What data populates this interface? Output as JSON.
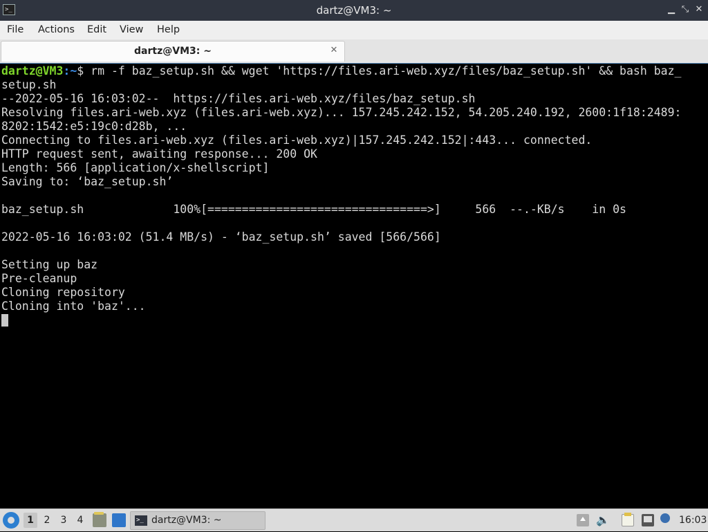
{
  "window": {
    "title": "dartz@VM3: ~",
    "app_icon_glyph": ">_",
    "minimize_glyph": "▁",
    "restore_glyph": "⤡",
    "close_glyph": "✕"
  },
  "menu": [
    "File",
    "Actions",
    "Edit",
    "View",
    "Help"
  ],
  "tab": {
    "label": "dartz@VM3: ~",
    "close_glyph": "✕"
  },
  "terminal": {
    "prompt_user": "dartz@VM3",
    "prompt_path": ":~",
    "prompt_symbol": "$",
    "command": " rm -f baz_setup.sh && wget 'https://files.ari-web.xyz/files/baz_setup.sh' && bash baz_",
    "output": "setup.sh\n--2022-05-16 16:03:02--  https://files.ari-web.xyz/files/baz_setup.sh\nResolving files.ari-web.xyz (files.ari-web.xyz)... 157.245.242.152, 54.205.240.192, 2600:1f18:2489:\n8202:1542:e5:19c0:d28b, ...\nConnecting to files.ari-web.xyz (files.ari-web.xyz)|157.245.242.152|:443... connected.\nHTTP request sent, awaiting response... 200 OK\nLength: 566 [application/x-shellscript]\nSaving to: ‘baz_setup.sh’\n\nbaz_setup.sh             100%[================================>]     566  --.-KB/s    in 0s\n\n2022-05-16 16:03:02 (51.4 MB/s) - ‘baz_setup.sh’ saved [566/566]\n\nSetting up baz\nPre-cleanup\nCloning repository\nCloning into 'baz'...\n"
  },
  "taskbar": {
    "workspaces": [
      "1",
      "2",
      "3",
      "4"
    ],
    "active_workspace": "1",
    "task_label": "dartz@VM3: ~",
    "task_icon_glyph": ">_",
    "volume_glyph": "🔈",
    "clock": "16:03"
  }
}
